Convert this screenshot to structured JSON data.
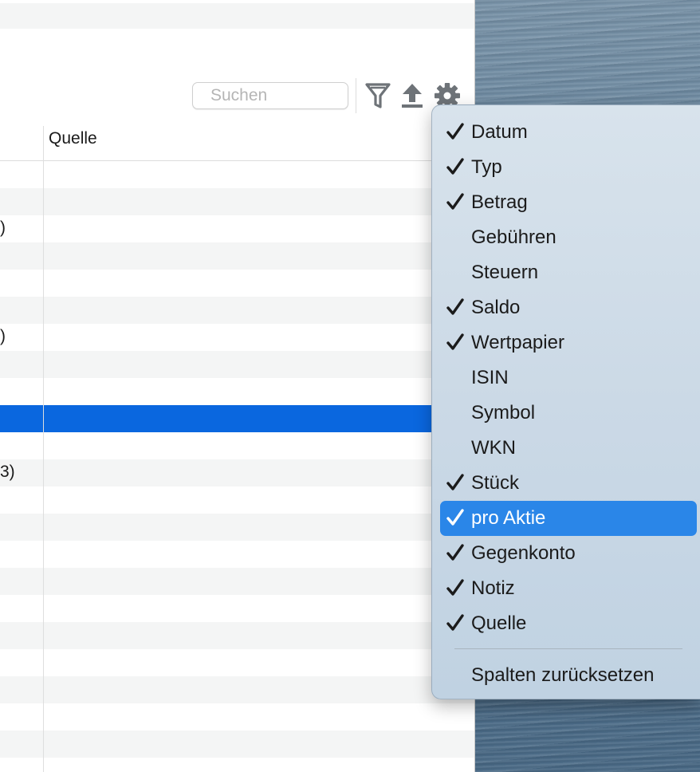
{
  "toolbar": {
    "search_placeholder": "Suchen",
    "filter_icon": "filter-funnel-icon",
    "export_icon": "export-upload-icon",
    "settings_icon": "gear-icon"
  },
  "table": {
    "column_header": "Quelle",
    "rows": [
      {
        "fragment": "",
        "alt": false,
        "selected": false
      },
      {
        "fragment": "",
        "alt": true,
        "selected": false
      },
      {
        "fragment": ")",
        "alt": false,
        "selected": false
      },
      {
        "fragment": "",
        "alt": true,
        "selected": false
      },
      {
        "fragment": "",
        "alt": false,
        "selected": false
      },
      {
        "fragment": "",
        "alt": true,
        "selected": false
      },
      {
        "fragment": ")",
        "alt": false,
        "selected": false
      },
      {
        "fragment": "",
        "alt": true,
        "selected": false
      },
      {
        "fragment": "",
        "alt": false,
        "selected": false
      },
      {
        "fragment": "",
        "alt": false,
        "selected": true
      },
      {
        "fragment": "",
        "alt": false,
        "selected": false
      },
      {
        "fragment": "3)",
        "alt": true,
        "selected": false
      },
      {
        "fragment": "",
        "alt": false,
        "selected": false
      },
      {
        "fragment": "",
        "alt": true,
        "selected": false
      },
      {
        "fragment": "",
        "alt": false,
        "selected": false
      },
      {
        "fragment": "",
        "alt": true,
        "selected": false
      },
      {
        "fragment": "",
        "alt": false,
        "selected": false
      },
      {
        "fragment": "",
        "alt": true,
        "selected": false
      },
      {
        "fragment": "",
        "alt": false,
        "selected": false
      },
      {
        "fragment": "",
        "alt": true,
        "selected": false
      },
      {
        "fragment": "",
        "alt": false,
        "selected": false
      },
      {
        "fragment": "",
        "alt": true,
        "selected": false
      },
      {
        "fragment": "",
        "alt": false,
        "selected": false
      }
    ]
  },
  "column_menu": {
    "items": [
      {
        "label": "Datum",
        "checked": true,
        "highlighted": false
      },
      {
        "label": "Typ",
        "checked": true,
        "highlighted": false
      },
      {
        "label": "Betrag",
        "checked": true,
        "highlighted": false
      },
      {
        "label": "Gebühren",
        "checked": false,
        "highlighted": false
      },
      {
        "label": "Steuern",
        "checked": false,
        "highlighted": false
      },
      {
        "label": "Saldo",
        "checked": true,
        "highlighted": false
      },
      {
        "label": "Wertpapier",
        "checked": true,
        "highlighted": false
      },
      {
        "label": "ISIN",
        "checked": false,
        "highlighted": false
      },
      {
        "label": "Symbol",
        "checked": false,
        "highlighted": false
      },
      {
        "label": "WKN",
        "checked": false,
        "highlighted": false
      },
      {
        "label": "Stück",
        "checked": true,
        "highlighted": false
      },
      {
        "label": "pro Aktie",
        "checked": true,
        "highlighted": true
      },
      {
        "label": "Gegenkonto",
        "checked": true,
        "highlighted": false
      },
      {
        "label": "Notiz",
        "checked": true,
        "highlighted": false
      },
      {
        "label": "Quelle",
        "checked": true,
        "highlighted": false
      }
    ],
    "reset_label": "Spalten zurücksetzen"
  },
  "colors": {
    "selection": "#0a67df",
    "menu_highlight": "#2a86e8",
    "row_alt": "#f4f5f5"
  }
}
